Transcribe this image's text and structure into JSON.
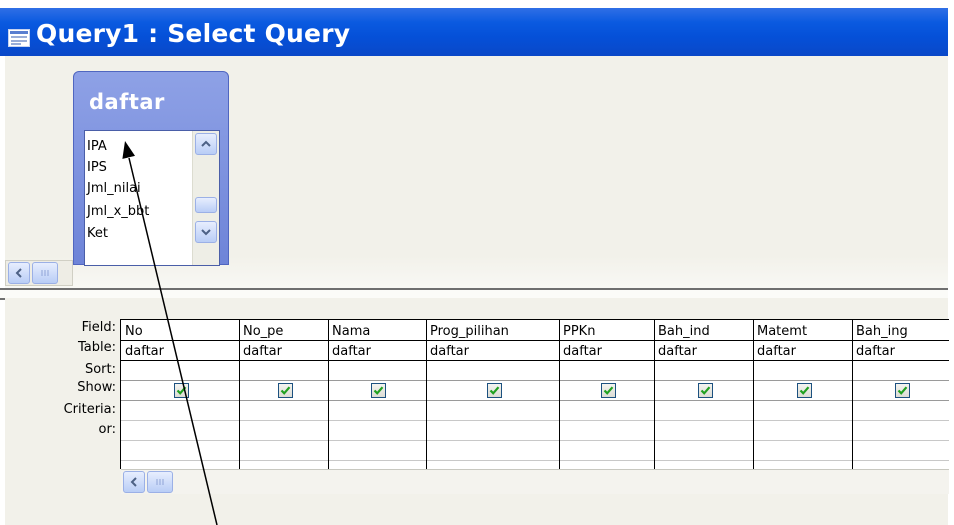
{
  "window": {
    "title": "Query1 : Select Query"
  },
  "table": {
    "name": "daftar",
    "fields": [
      "IPA",
      "IPS",
      "Jml_nilai",
      "Jml_x_bbt",
      "Ket"
    ]
  },
  "grid": {
    "row_labels": [
      "Field:",
      "Table:",
      "Sort:",
      "Show:",
      "Criteria:",
      "or:"
    ],
    "columns": [
      {
        "field": "No",
        "table": "daftar",
        "show": true
      },
      {
        "field": "No_pe",
        "table": "daftar",
        "show": true
      },
      {
        "field": "Nama",
        "table": "daftar",
        "show": true
      },
      {
        "field": "Prog_pilihan",
        "table": "daftar",
        "show": true
      },
      {
        "field": "PPKn",
        "table": "daftar",
        "show": true
      },
      {
        "field": "Bah_ind",
        "table": "daftar",
        "show": true
      },
      {
        "field": "Matemt",
        "table": "daftar",
        "show": true
      },
      {
        "field": "Bah_ing",
        "table": "daftar",
        "show": true
      }
    ]
  },
  "icons": {
    "title": "query-window-icon",
    "scroll_up": "chevron-up-icon",
    "scroll_down": "chevron-down-icon",
    "scroll_left": "chevron-left-icon",
    "checkbox_mark": "check-icon"
  },
  "colors": {
    "title_bar": "#0a5ae0",
    "table_header": "#7b8fe0",
    "check": "#21a121"
  }
}
